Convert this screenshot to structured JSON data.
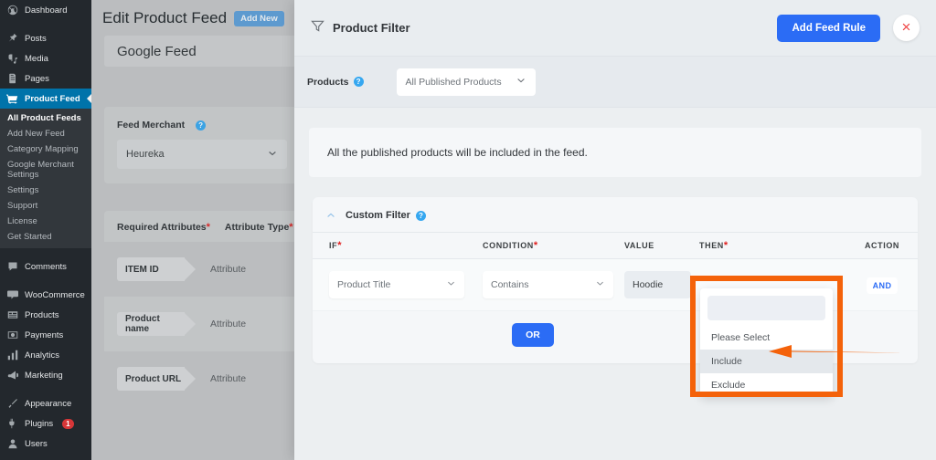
{
  "wp_sidebar": {
    "items": [
      {
        "label": "Dashboard",
        "icon": "dashboard-icon",
        "active": false
      },
      {
        "label": "Posts",
        "icon": "pin-icon",
        "active": false
      },
      {
        "label": "Media",
        "icon": "media-icon",
        "active": false
      },
      {
        "label": "Pages",
        "icon": "pages-icon",
        "active": false
      },
      {
        "label": "Product Feed",
        "icon": "cart-icon",
        "active": true
      },
      {
        "label": "Comments",
        "icon": "comment-icon",
        "active": false
      },
      {
        "label": "WooCommerce",
        "icon": "woocommerce-icon",
        "active": false
      },
      {
        "label": "Products",
        "icon": "products-icon",
        "active": false
      },
      {
        "label": "Payments",
        "icon": "payments-icon",
        "active": false
      },
      {
        "label": "Analytics",
        "icon": "analytics-icon",
        "active": false
      },
      {
        "label": "Marketing",
        "icon": "megaphone-icon",
        "active": false
      },
      {
        "label": "Appearance",
        "icon": "brush-icon",
        "active": false
      },
      {
        "label": "Plugins",
        "icon": "plug-icon",
        "active": false,
        "badge": "1"
      },
      {
        "label": "Users",
        "icon": "users-icon",
        "active": false
      }
    ],
    "submenu": [
      {
        "label": "All Product Feeds",
        "current": true
      },
      {
        "label": "Add New Feed",
        "current": false
      },
      {
        "label": "Category Mapping",
        "current": false
      },
      {
        "label": "Google Merchant Settings",
        "current": false
      },
      {
        "label": "Settings",
        "current": false
      },
      {
        "label": "Support",
        "current": false
      },
      {
        "label": "License",
        "current": false
      },
      {
        "label": "Get Started",
        "current": false
      }
    ]
  },
  "background_page": {
    "title": "Edit Product Feed",
    "add_new_label": "Add New",
    "feed_name": "Google Feed",
    "merchant_label": "Feed Merchant",
    "merchant_value": "Heureka",
    "attributes_header": {
      "required_attributes": "Required Attributes",
      "attribute_type": "Attribute Type",
      "required_marker": "*"
    },
    "attribute_rows": [
      {
        "name": "ITEM ID",
        "type": "Attribute"
      },
      {
        "name": "Product name",
        "type": "Attribute"
      },
      {
        "name": "Product URL",
        "type": "Attribute"
      }
    ]
  },
  "modal": {
    "header": {
      "title": "Product Filter",
      "filter_icon": "funnel-icon",
      "add_feed_rule_label": "Add Feed Rule",
      "close_icon": "close-icon",
      "primary_color": "#2b6cf5",
      "close_color": "#ef4444"
    },
    "products_bar": {
      "label": "Products",
      "help_icon": "help-circle-icon",
      "selected": "All Published Products",
      "chevron_icon": "chevron-down-icon"
    },
    "info_message": "All the published products will be included in the feed.",
    "custom_filter": {
      "title": "Custom Filter",
      "help_icon": "help-circle-icon",
      "collapse_icon": "chevron-up-icon",
      "columns": {
        "if": "IF",
        "condition": "CONDITION",
        "value": "VALUE",
        "then": "THEN",
        "action": "ACTION"
      },
      "required_marker": "*",
      "row": {
        "if_value": "Product Title",
        "condition_value": "Contains",
        "value_text": "Hoodie",
        "then_value": "",
        "action_label": "AND"
      },
      "or_button": "OR"
    },
    "then_dropdown": {
      "open": true,
      "options": [
        {
          "label": "Please Select",
          "highlighted": false
        },
        {
          "label": "Include",
          "highlighted": true
        },
        {
          "label": "Exclude",
          "highlighted": false
        }
      ]
    }
  },
  "annotation": {
    "highlight_color": "#f4620a",
    "arrow_icon": "left-arrow-annotation",
    "box_target": "then-dropdown"
  }
}
